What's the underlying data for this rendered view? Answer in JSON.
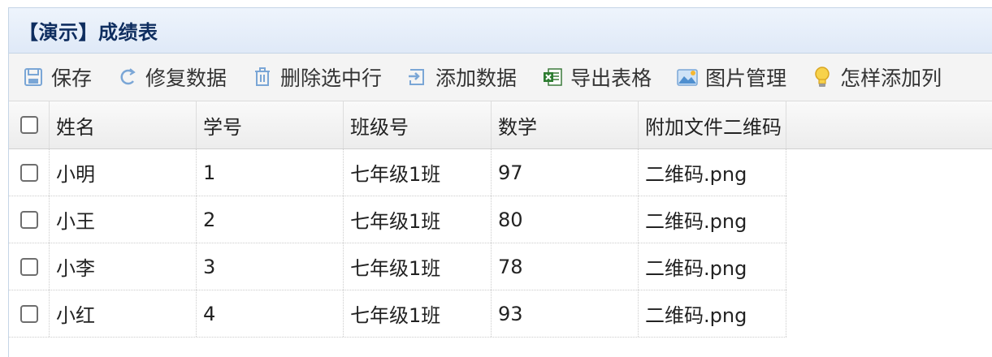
{
  "panel": {
    "title": "【演示】成绩表"
  },
  "toolbar": {
    "buttons": [
      {
        "label": "保存",
        "icon": "save-icon"
      },
      {
        "label": "修复数据",
        "icon": "refresh-icon"
      },
      {
        "label": "删除选中行",
        "icon": "trash-icon"
      },
      {
        "label": "添加数据",
        "icon": "add-icon"
      },
      {
        "label": "导出表格",
        "icon": "excel-icon"
      },
      {
        "label": "图片管理",
        "icon": "image-icon"
      },
      {
        "label": "怎样添加列",
        "icon": "lightbulb-icon"
      }
    ]
  },
  "table": {
    "headers": [
      "姓名",
      "学号",
      "班级号",
      "数学",
      "附加文件二维码"
    ],
    "rows": [
      [
        "小明",
        "1",
        "七年级1班",
        "97",
        "二维码.png"
      ],
      [
        "小王",
        "2",
        "七年级1班",
        "80",
        "二维码.png"
      ],
      [
        "小李",
        "3",
        "七年级1班",
        "78",
        "二维码.png"
      ],
      [
        "小红",
        "4",
        "七年级1班",
        "93",
        "二维码.png"
      ]
    ]
  },
  "colors": {
    "header_title": "#0e2d5f",
    "header_bg": "#dfe9f7",
    "icon_blue": "#6a9bd1"
  }
}
